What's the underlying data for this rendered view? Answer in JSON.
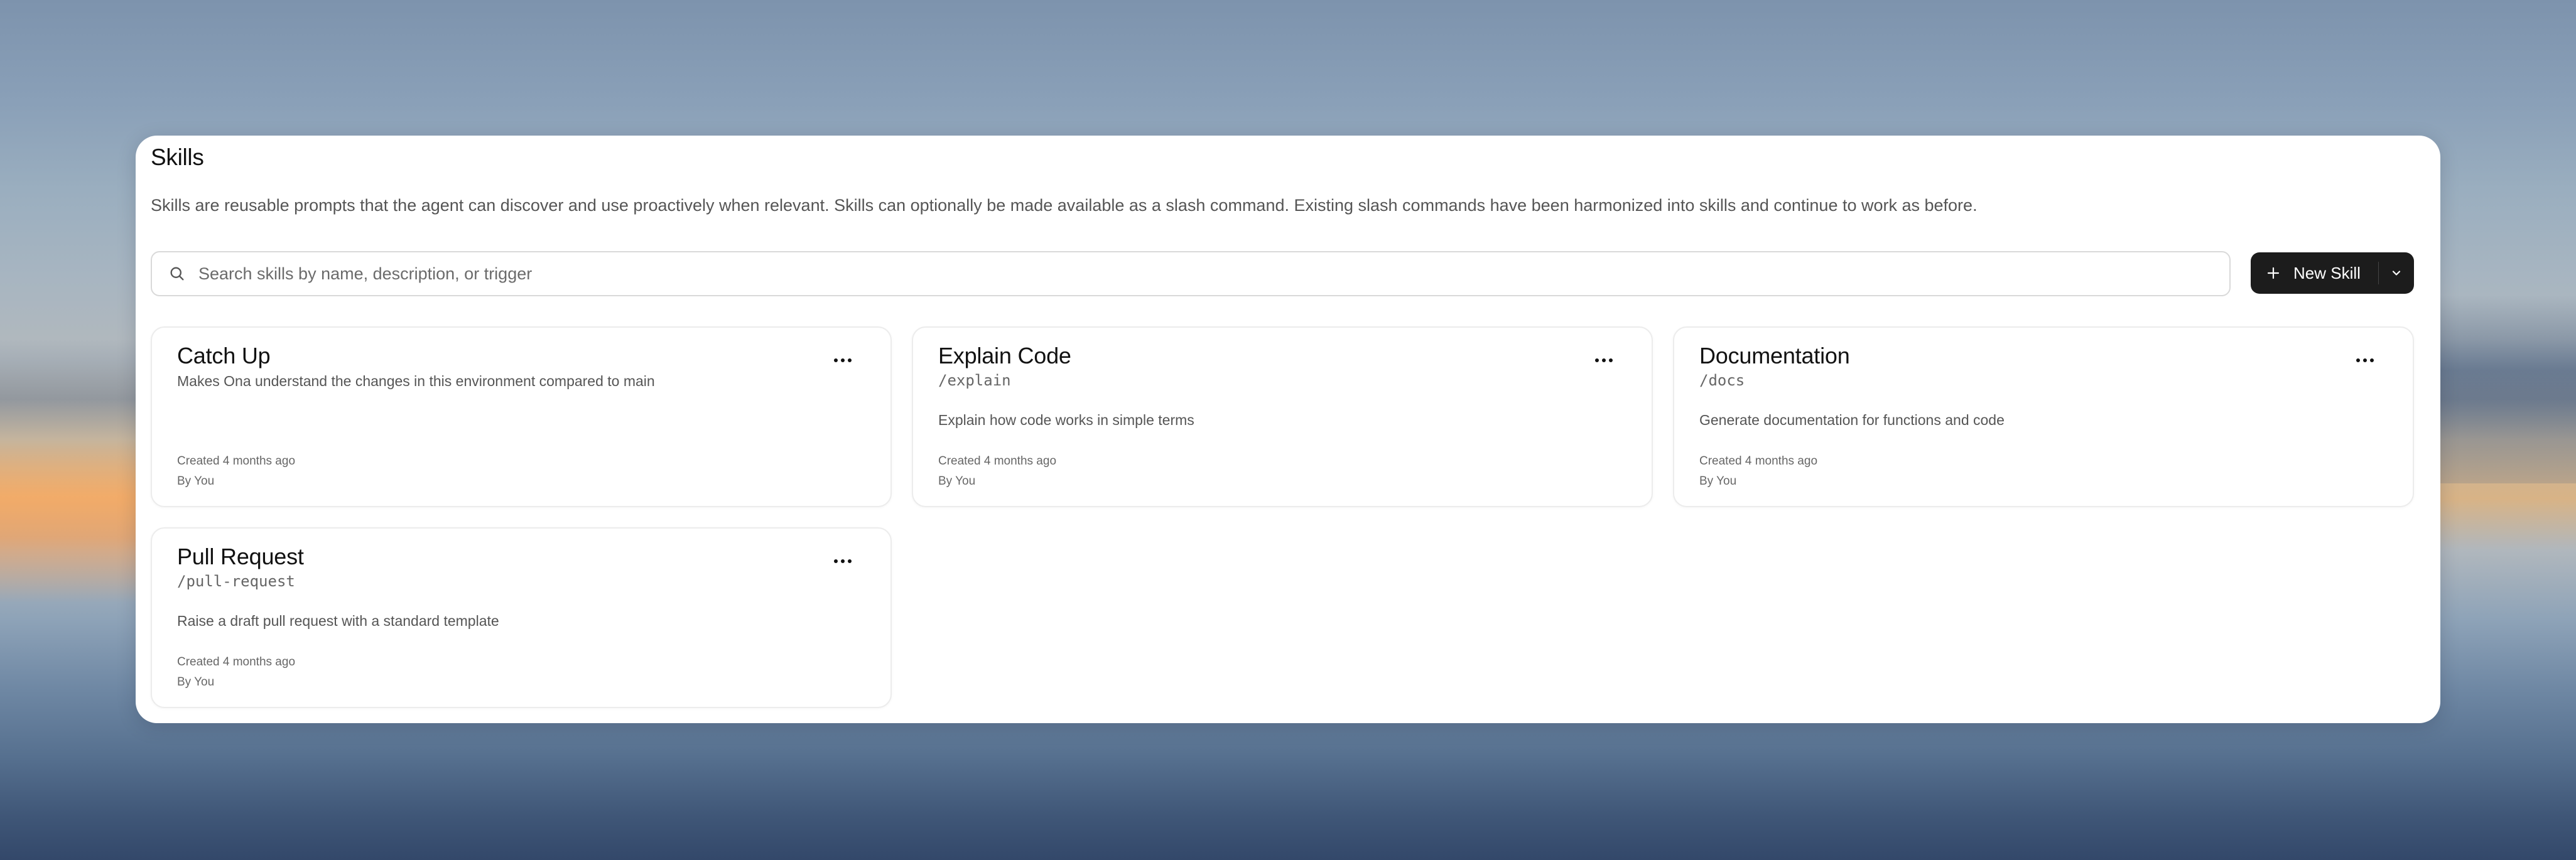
{
  "page": {
    "title": "Skills",
    "description": "Skills are reusable prompts that the agent can discover and use proactively when relevant. Skills can optionally be made available as a slash command. Existing slash commands have been harmonized into skills and continue to work as before."
  },
  "search": {
    "placeholder": "Search skills by name, description, or trigger",
    "value": "",
    "icon": "search-icon"
  },
  "new_skill_button": {
    "label": "New Skill",
    "icon": "plus-icon",
    "dropdown_icon": "chevron-down-icon"
  },
  "skills": [
    {
      "name": "Catch Up",
      "trigger": "",
      "description": "Makes Ona understand the changes in this environment compared to main",
      "created": "Created 4 months ago",
      "author": "By You"
    },
    {
      "name": "Explain Code",
      "trigger": "/explain",
      "description": "Explain how code works in simple terms",
      "created": "Created 4 months ago",
      "author": "By You"
    },
    {
      "name": "Documentation",
      "trigger": "/docs",
      "description": "Generate documentation for functions and code",
      "created": "Created 4 months ago",
      "author": "By You"
    },
    {
      "name": "Pull Request",
      "trigger": "/pull-request",
      "description": "Raise a draft pull request with a standard template",
      "created": "Created 4 months ago",
      "author": "By You"
    }
  ],
  "colors": {
    "panel_bg": "#ffffff",
    "button_bg": "#1c1c1c",
    "text_primary": "#111111",
    "text_secondary": "#555555"
  }
}
